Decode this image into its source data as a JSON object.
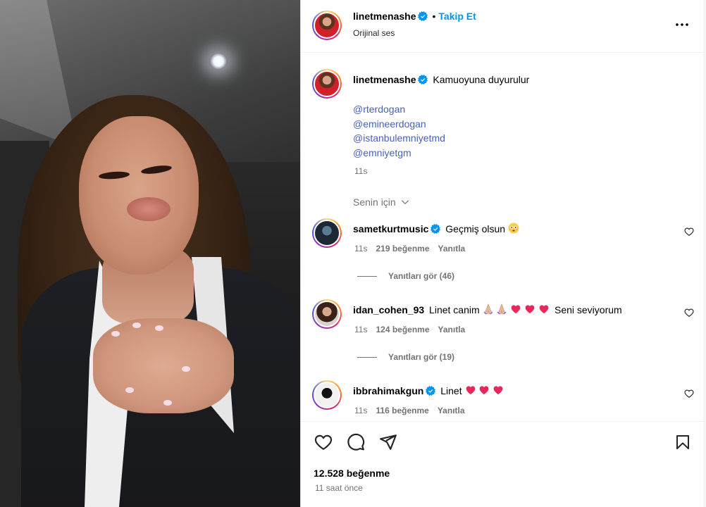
{
  "post": {
    "author": "linetmenashe",
    "follow_label": "Takip Et",
    "audio": "Orijinal ses",
    "more_icon": "more-icon"
  },
  "caption": {
    "username": "linetmenashe",
    "text": "Kamuoyuna duyurulur",
    "mentions": [
      "@rterdogan",
      "@emineerdogan",
      "@istanbulemniyetmd",
      "@emniyetgm"
    ],
    "time": "11s"
  },
  "filter": {
    "label": "Senin için"
  },
  "comments": [
    {
      "username": "sametkurtmusic",
      "verified": true,
      "text": "Geçmiş olsun",
      "emojis": [
        "flushed-face"
      ],
      "time": "11s",
      "likes": "219 beğenme",
      "reply": "Yanıtla",
      "replies_label": "Yanıtları gör (46)"
    },
    {
      "username": "idan_cohen_93",
      "verified": false,
      "text": "Linet canim",
      "text_after": "Seni seviyorum",
      "emojis": [
        "folded-hands",
        "folded-hands",
        "heart",
        "heart",
        "heart"
      ],
      "time": "11s",
      "likes": "124 beğenme",
      "reply": "Yanıtla",
      "replies_label": "Yanıtları gör (19)"
    },
    {
      "username": "ibbrahimakgun",
      "verified": true,
      "text": "Linet",
      "emojis": [
        "heart",
        "heart",
        "heart"
      ],
      "time": "11s",
      "likes": "116 beğenme",
      "reply": "Yanıtla"
    }
  ],
  "footer": {
    "likes": "12.528 beğenme",
    "time_ago": "11 saat önce"
  },
  "colors": {
    "link_blue": "#0095f6",
    "mention_blue": "#4662b9",
    "verified_blue": "#0095f6",
    "heart_pink": "#e8285a",
    "muted": "#737373"
  }
}
